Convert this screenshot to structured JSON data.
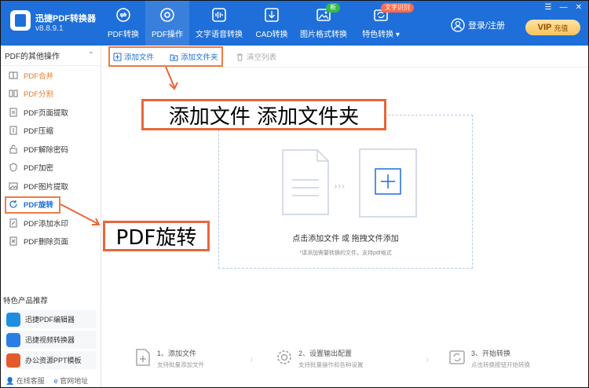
{
  "app": {
    "name": "迅捷PDF转换器",
    "version": "v8.8.9.1"
  },
  "nav": [
    {
      "label": "PDF转换"
    },
    {
      "label": "PDF操作"
    },
    {
      "label": "文字语音转换"
    },
    {
      "label": "CAD转换"
    },
    {
      "label": "图片格式转换",
      "badge": "新"
    },
    {
      "label": "特色转换",
      "badge": "文字识别"
    }
  ],
  "header": {
    "login": "登录/注册",
    "vip": "VIP",
    "vip_sub": "充值"
  },
  "sidebar": {
    "title": "PDF的其他操作",
    "items": [
      {
        "label": "PDF合并"
      },
      {
        "label": "PDF分割"
      },
      {
        "label": "PDF页面提取"
      },
      {
        "label": "PDF压缩"
      },
      {
        "label": "PDF解除密码"
      },
      {
        "label": "PDF加密"
      },
      {
        "label": "PDF图片提取"
      },
      {
        "label": "PDF旋转"
      },
      {
        "label": "PDF添加水印"
      },
      {
        "label": "PDF删除页面"
      }
    ],
    "featured_title": "特色产品推荐",
    "featured": [
      {
        "label": "迅捷PDF编辑器"
      },
      {
        "label": "迅捷视频转换器"
      },
      {
        "label": "办公资源PPT模板"
      }
    ],
    "footer": {
      "service": "在线客服",
      "website": "官网地址"
    }
  },
  "toolbar": {
    "add_file": "添加文件",
    "add_folder": "添加文件夹",
    "clear_list": "清空列表"
  },
  "drop": {
    "title": "点击添加文件 或 拖拽文件添加",
    "hint": "*请添加需要转换的文件，支持pdf格式"
  },
  "annotations": {
    "top": "添加文件  添加文件夹",
    "side": "PDF旋转"
  },
  "steps": [
    {
      "title": "1、添加文件",
      "desc": "支持批量添加文件"
    },
    {
      "title": "2、设置输出配置",
      "desc": "支持批量操作和各种设置"
    },
    {
      "title": "3、开始转换",
      "desc": "点击转换按钮开始转换"
    }
  ],
  "colors": {
    "brand": "#1e6fd9",
    "accent": "#e8663a",
    "active": "#1e6fd9",
    "orange_text": "#e8762d"
  }
}
